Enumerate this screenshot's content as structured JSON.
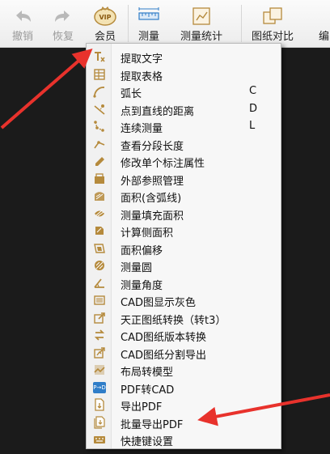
{
  "toolbar": {
    "undo": "撤销",
    "redo": "恢复",
    "vip": "会员",
    "vip_badge": "VIP",
    "measure": "测量",
    "measure_stats": "测量统计",
    "compare": "图纸对比",
    "edit_partial": "编"
  },
  "menu": {
    "items": [
      {
        "label": "提取文字",
        "key": "",
        "icon": "extract-text-icon"
      },
      {
        "label": "提取表格",
        "key": "",
        "icon": "extract-table-icon"
      },
      {
        "label": "弧长",
        "key": "C",
        "icon": "arc-length-icon"
      },
      {
        "label": "点到直线的距离",
        "key": "D",
        "icon": "point-line-distance-icon"
      },
      {
        "label": "连续测量",
        "key": "L",
        "icon": "continuous-measure-icon"
      },
      {
        "label": "查看分段长度",
        "key": "",
        "icon": "segment-length-icon"
      },
      {
        "label": "修改单个标注属性",
        "key": "",
        "icon": "edit-annotation-icon"
      },
      {
        "label": "外部参照管理",
        "key": "",
        "icon": "xref-icon"
      },
      {
        "label": "面积(含弧线)",
        "key": "",
        "icon": "area-arc-icon"
      },
      {
        "label": "测量填充面积",
        "key": "",
        "icon": "fill-area-icon"
      },
      {
        "label": "计算侧面积",
        "key": "",
        "icon": "side-area-icon"
      },
      {
        "label": "面积偏移",
        "key": "",
        "icon": "area-offset-icon"
      },
      {
        "label": "测量圆",
        "key": "",
        "icon": "circle-measure-icon"
      },
      {
        "label": "测量角度",
        "key": "",
        "icon": "angle-icon"
      },
      {
        "label": "CAD图显示灰色",
        "key": "",
        "icon": "gray-display-icon"
      },
      {
        "label": "天正图纸转换（转t3）",
        "key": "",
        "icon": "tangent-convert-icon"
      },
      {
        "label": "CAD图纸版本转换",
        "key": "",
        "icon": "version-convert-icon"
      },
      {
        "label": "CAD图纸分割导出",
        "key": "",
        "icon": "split-export-icon"
      },
      {
        "label": "布局转模型",
        "key": "",
        "icon": "layout-model-icon"
      },
      {
        "label": "PDF转CAD",
        "key": "",
        "icon": "pdf-to-cad-icon"
      },
      {
        "label": "导出PDF",
        "key": "",
        "icon": "export-pdf-icon"
      },
      {
        "label": "批量导出PDF",
        "key": "",
        "icon": "batch-export-pdf-icon"
      },
      {
        "label": "快捷键设置",
        "key": "",
        "icon": "shortcut-settings-icon"
      }
    ],
    "pdf_badge": "P→D"
  },
  "colors": {
    "icon_gold": "#b58a3c",
    "arrow_red": "#e8322c",
    "measure_blue": "#2f7dc8"
  }
}
